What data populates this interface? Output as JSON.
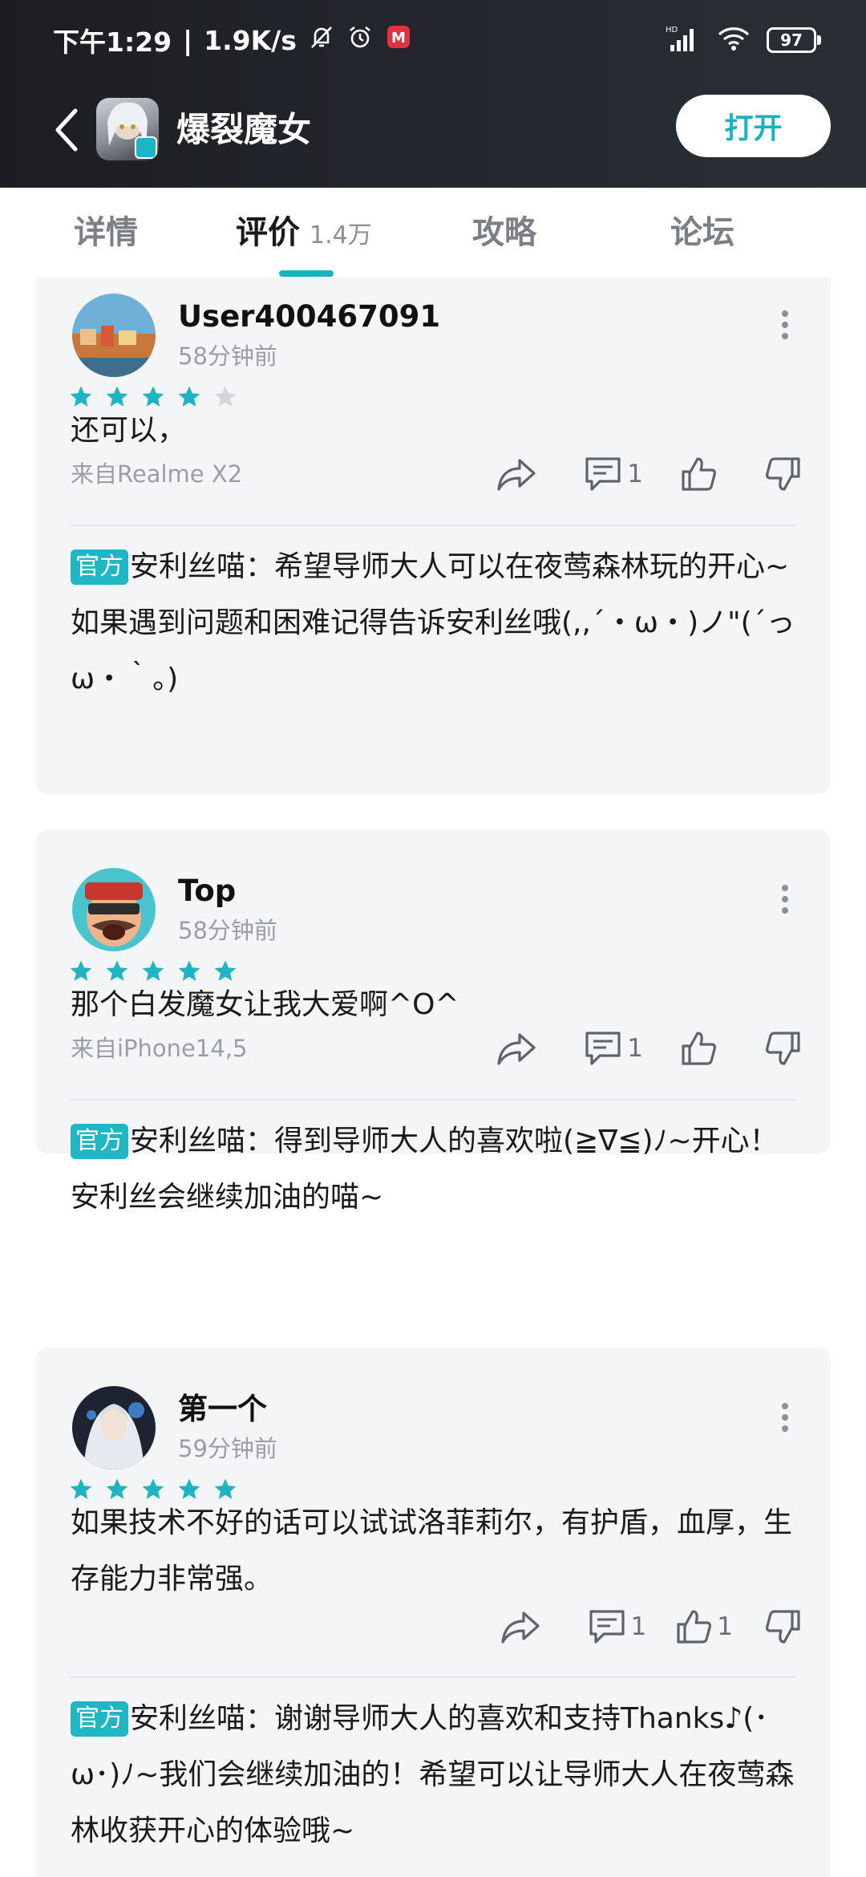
{
  "status_bar": {
    "time": "下午1:29",
    "separator": "|",
    "speed": "1.9K/s",
    "battery": "97",
    "icons": [
      "mute-bell-icon",
      "alarm-icon",
      "app-notification-icon",
      "hd-signal-icon",
      "wifi-icon",
      "battery-icon"
    ]
  },
  "header": {
    "back_icon": "chevron-left-icon",
    "title": "爆裂魔女",
    "open_button": "打开"
  },
  "tabs": [
    {
      "label": "详情"
    },
    {
      "label": "评价",
      "count": "1.4万",
      "active": true
    },
    {
      "label": "攻略"
    },
    {
      "label": "论坛"
    }
  ],
  "colors": {
    "accent": "#17b3c0",
    "star_on": "#1fb4c4",
    "star_off": "#d3d5d9",
    "card_bg": "#f4f5f7"
  },
  "reviews": [
    {
      "username": "User400467091",
      "time": "58分钟前",
      "rating": 4,
      "text": "还可以，",
      "device": "来自Realme X2",
      "comments": "1",
      "likes": "",
      "reply": {
        "tag": "官方",
        "text": "安利丝喵：希望导师大人可以在夜莺森林玩的开心~如果遇到问题和困难记得告诉安利丝哦(,,´・ω・)ノ\"(´っω・｀。)"
      }
    },
    {
      "username": "Top",
      "time": "58分钟前",
      "rating": 5,
      "text": "那个白发魔女让我大爱啊^O^",
      "device": "来自iPhone14,5",
      "comments": "1",
      "likes": "",
      "reply": {
        "tag": "官方",
        "text": "安利丝喵：得到导师大人的喜欢啦(≧∇≦)ﾉ~开心！安利丝会继续加油的喵~"
      }
    },
    {
      "username": "第一个",
      "time": "59分钟前",
      "rating": 5,
      "text": "如果技术不好的话可以试试洛菲莉尔，有护盾，血厚，生存能力非常强。",
      "device": "",
      "comments": "1",
      "likes": "1",
      "reply": {
        "tag": "官方",
        "text": "安利丝喵：谢谢导师大人的喜欢和支持Thanks♪(･ω･)ﾉ~我们会继续加油的！希望可以让导师大人在夜莺森林收获开心的体验哦~"
      }
    }
  ]
}
